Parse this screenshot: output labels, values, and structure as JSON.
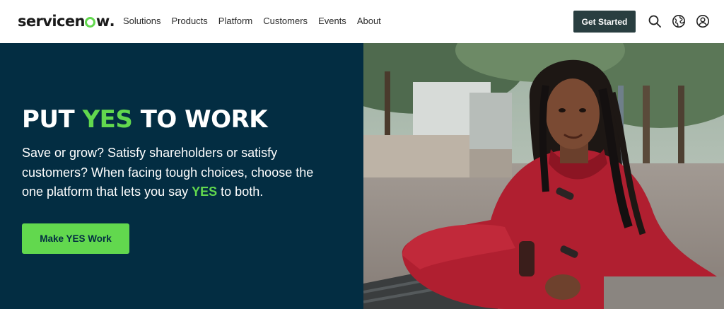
{
  "brand": {
    "name_prefix": "servicen",
    "name_suffix": "w",
    "trademark": "."
  },
  "nav": {
    "items": [
      {
        "label": "Solutions"
      },
      {
        "label": "Products"
      },
      {
        "label": "Platform"
      },
      {
        "label": "Customers"
      },
      {
        "label": "Events"
      },
      {
        "label": "About"
      }
    ]
  },
  "header": {
    "cta_label": "Get Started",
    "icons": [
      "search-icon",
      "globe-icon",
      "user-account-icon"
    ]
  },
  "hero": {
    "title_part1": "PUT ",
    "title_highlight": "YES",
    "title_part2": " TO WORK",
    "body_line1": "Save or grow? Satisfy shareholders or satisfy",
    "body_line2": "customers? When facing tough choices, choose the",
    "body_line3_pre": "one platform that lets you say ",
    "body_line3_highlight": "YES",
    "body_line3_post": " to both.",
    "cta_label": "Make YES Work",
    "image": "woman-in-red-coat-on-bench-photo"
  },
  "colors": {
    "accent_green": "#62d84e",
    "hero_bg": "#032d42",
    "header_cta_bg": "#293e40"
  }
}
